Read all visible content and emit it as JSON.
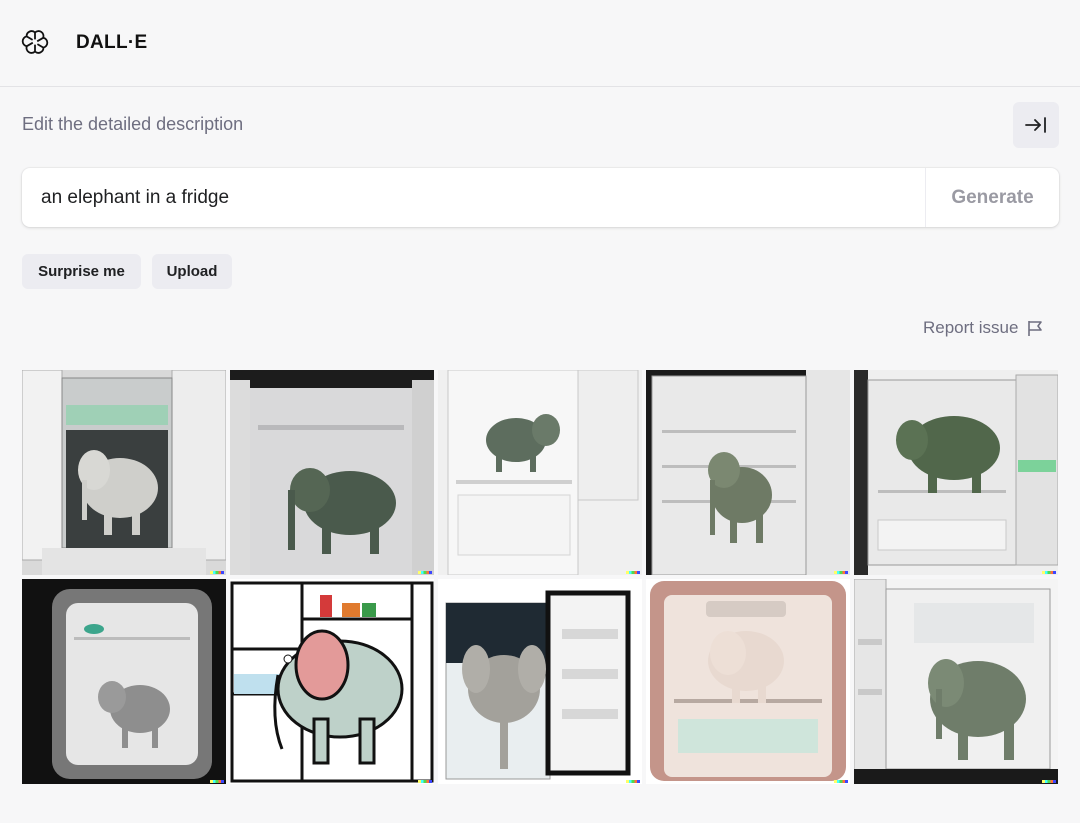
{
  "header": {
    "app_title": "DALL·E",
    "logo_icon": "openai-logo-icon"
  },
  "prompt": {
    "label": "Edit the detailed description",
    "value": "an elephant in a fridge",
    "generate_label": "Generate",
    "collapse_icon": "arrow-right-to-bar-icon"
  },
  "actions": {
    "surprise_label": "Surprise me",
    "upload_label": "Upload"
  },
  "report": {
    "label": "Report issue",
    "icon": "flag-icon"
  },
  "results": {
    "images": [
      {
        "name": "result-image-1",
        "style": "photo-white-fridge-grey-elephant"
      },
      {
        "name": "result-image-2",
        "style": "photo-open-fridge-dark-elephant"
      },
      {
        "name": "result-image-3",
        "style": "photo-white-fridge-small-elephant"
      },
      {
        "name": "result-image-4",
        "style": "photo-white-fridge-shelves-elephant"
      },
      {
        "name": "result-image-5",
        "style": "photo-fridge-green-elephant"
      },
      {
        "name": "result-image-6",
        "style": "photo-dark-fridge-grey-elephant"
      },
      {
        "name": "result-image-7",
        "style": "cartoon-elephant-in-fridge"
      },
      {
        "name": "result-image-8",
        "style": "photo-fridge-front-elephant"
      },
      {
        "name": "result-image-9",
        "style": "photo-beige-fridge-elephant"
      },
      {
        "name": "result-image-10",
        "style": "photo-white-fridge-big-elephant"
      }
    ]
  },
  "colors": {
    "background": "#f7f7f8",
    "chip": "#ececf1",
    "muted_text": "#6e6e80",
    "generate_disabled": "#9a9aa3"
  }
}
